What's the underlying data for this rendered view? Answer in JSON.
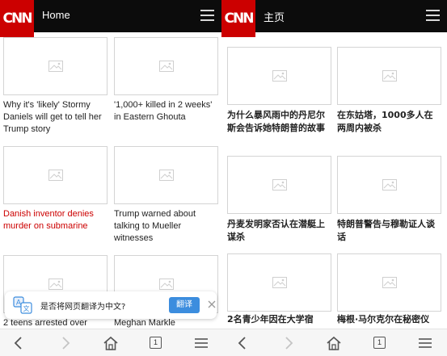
{
  "left": {
    "logo": "CNN",
    "nav_title": "Home",
    "articles": [
      {
        "headline": "Why it's 'likely' Stormy Daniels will get to tell her Trump story"
      },
      {
        "headline": "'1,000+ killed in 2 weeks' in Eastern Ghouta"
      },
      {
        "headline": "Danish inventor denies murder on submarine"
      },
      {
        "headline": "Trump warned about talking to Mueller witnesses"
      },
      {
        "headline": "2 teens arrested over"
      },
      {
        "headline": "Meghan Markle"
      }
    ],
    "translate_prompt": {
      "message": "是否将网页翻译为中文?",
      "button_label": "翻译"
    },
    "tab_count": "1"
  },
  "right": {
    "logo": "CNN",
    "nav_title": "主页",
    "articles": [
      {
        "headline": "为什么暴风雨中的丹尼尔斯会告诉她特朗普的故事"
      },
      {
        "headline": "在东姑塔，1000多人在两周内被杀"
      },
      {
        "headline": "丹麦发明家否认在潜艇上谋杀"
      },
      {
        "headline": "特朗普警告与穆勒证人谈话"
      },
      {
        "headline": "2名青少年因在大学宿"
      },
      {
        "headline": "梅根·马尔克尔在秘密仪"
      }
    ],
    "tab_count": "1"
  },
  "colors": {
    "brand_red": "#cc0000",
    "topbar": "#0c0c0c",
    "translate_button": "#3c8dde",
    "highlight_headline": "#cc0000"
  },
  "icons": [
    "menu-icon",
    "image-placeholder-icon",
    "translate-icon",
    "close-icon",
    "back-icon",
    "forward-icon",
    "home-icon",
    "tabs-icon"
  ]
}
